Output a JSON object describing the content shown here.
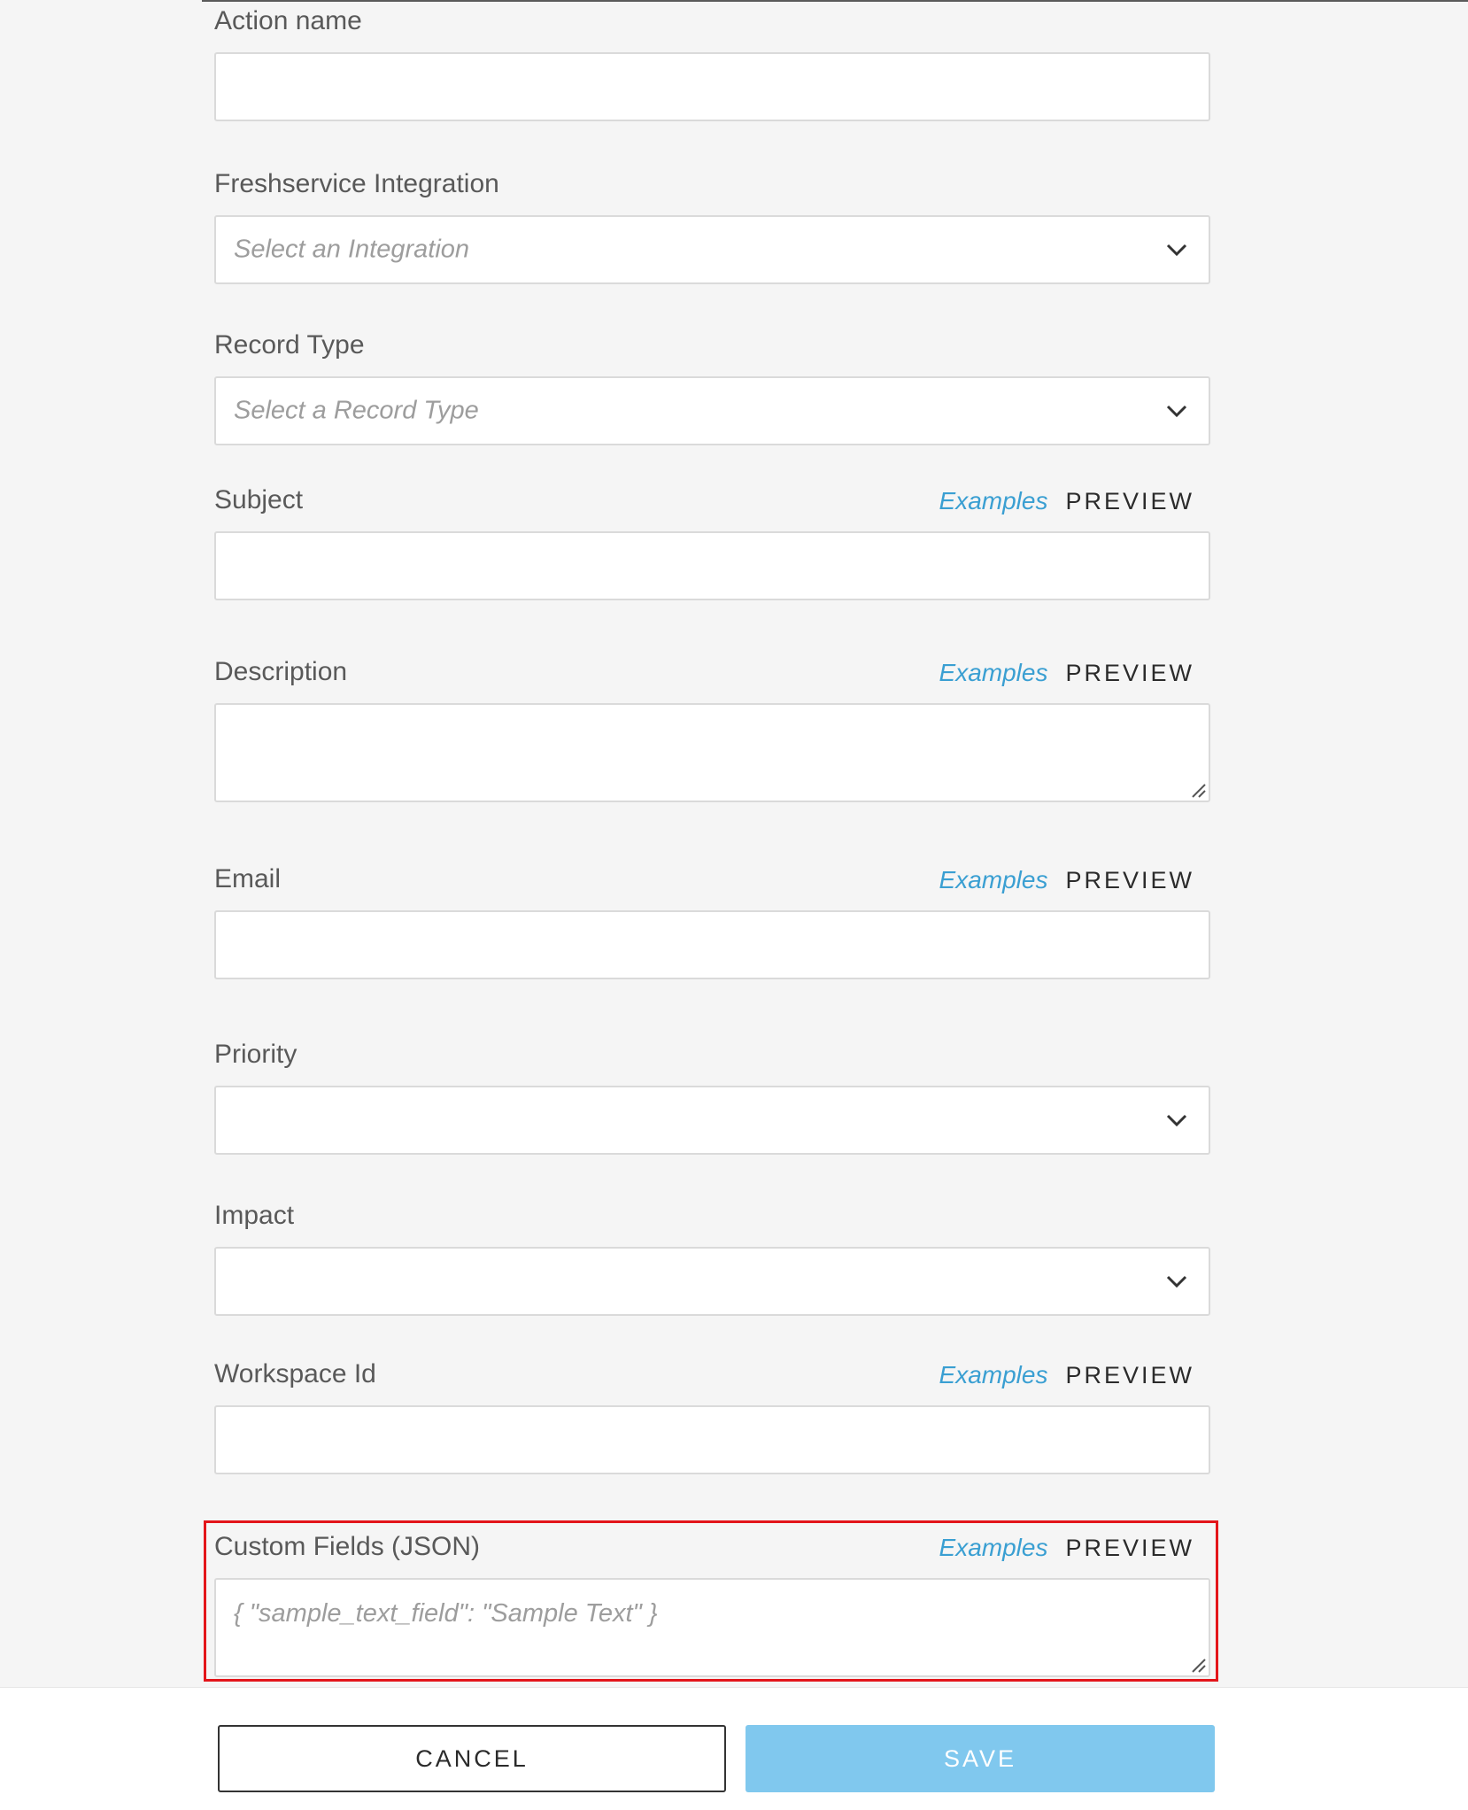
{
  "form": {
    "action_name": {
      "label": "Action name",
      "value": ""
    },
    "integration": {
      "label": "Freshservice Integration",
      "placeholder": "Select an Integration"
    },
    "record_type": {
      "label": "Record Type",
      "placeholder": "Select a Record Type"
    },
    "subject": {
      "label": "Subject",
      "value": ""
    },
    "description": {
      "label": "Description",
      "value": ""
    },
    "email": {
      "label": "Email",
      "value": ""
    },
    "priority": {
      "label": "Priority",
      "value": ""
    },
    "impact": {
      "label": "Impact",
      "value": ""
    },
    "workspace_id": {
      "label": "Workspace Id",
      "value": ""
    },
    "custom_fields": {
      "label": "Custom Fields (JSON)",
      "placeholder": "{ \"sample_text_field\": \"Sample Text\" }"
    },
    "examples_label": "Examples",
    "preview_label": "PREVIEW"
  },
  "footer": {
    "cancel_label": "CANCEL",
    "save_label": "SAVE"
  },
  "colors": {
    "background": "#f5f5f5",
    "link": "#3a9fd2",
    "save_button": "#80c8ee",
    "highlight": "#e3151a"
  },
  "icons": {
    "dropdown": "chevron-down-icon",
    "textarea_resize": "resize-grip-icon"
  }
}
